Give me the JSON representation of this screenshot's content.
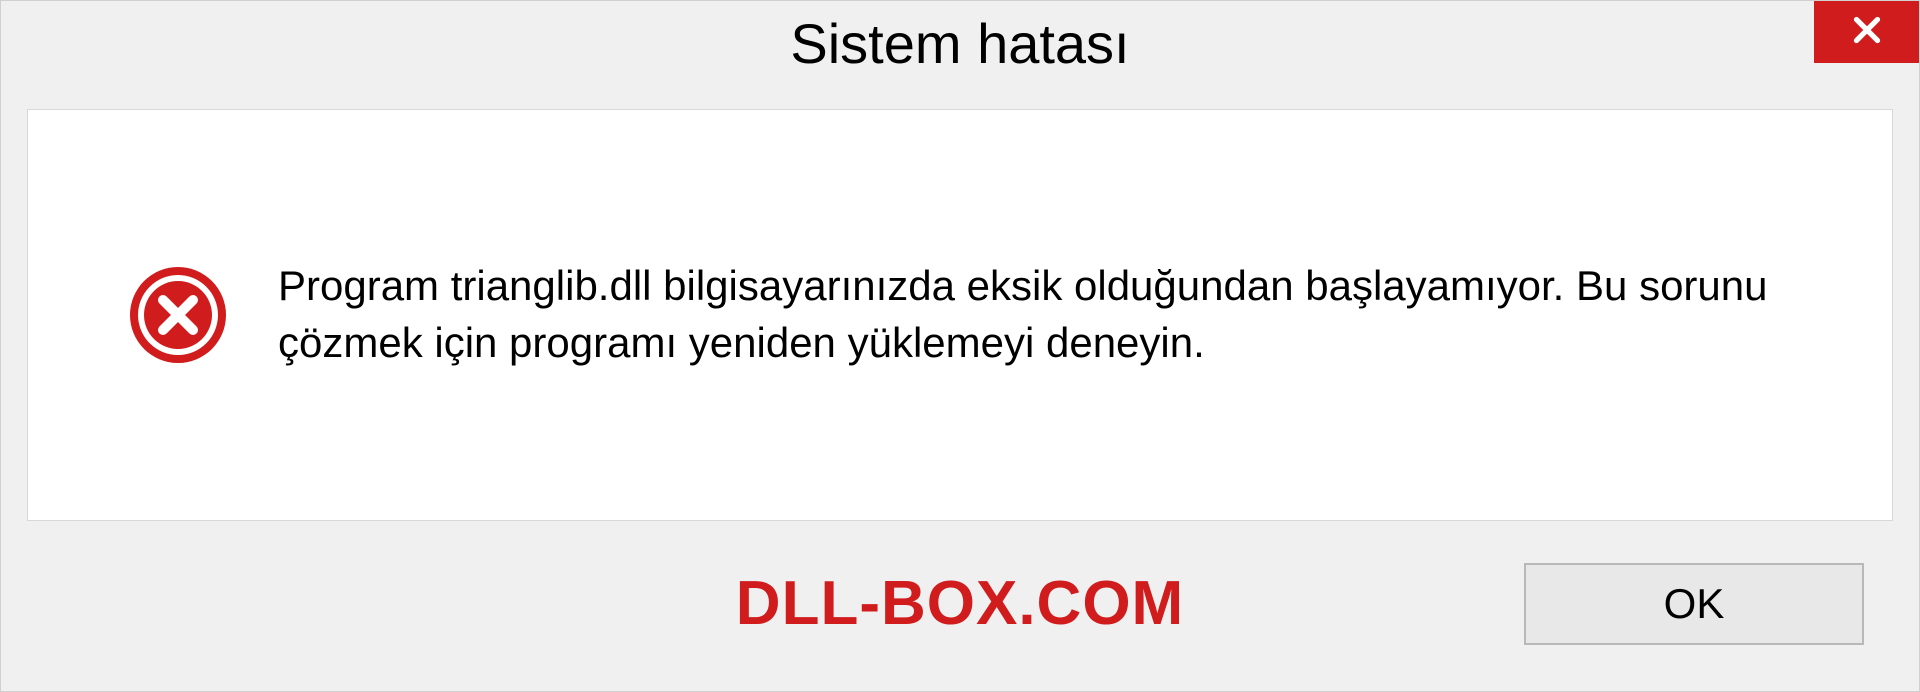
{
  "dialog": {
    "title": "Sistem hatası",
    "message": "Program trianglib.dll bilgisayarınızda eksik olduğundan başlayamıyor. Bu sorunu çözmek için programı yeniden yüklemeyi deneyin.",
    "ok_label": "OK"
  },
  "watermark": "DLL-BOX.COM",
  "colors": {
    "close_bg": "#d01c1c",
    "error_icon": "#d01c1c",
    "watermark": "#d01c1c"
  }
}
